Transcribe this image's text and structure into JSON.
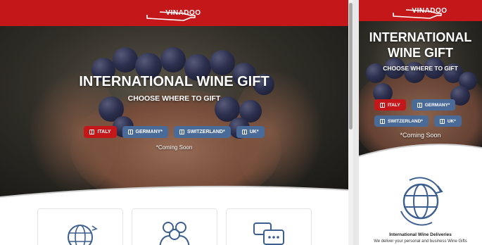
{
  "brand": {
    "name": "VINADOO"
  },
  "hero": {
    "title": "INTERNATIONAL WINE GIFT",
    "mobile_title": "INTERNATIONAL WINE GIFT",
    "subtitle": "CHOOSE WHERE TO GIFT",
    "coming_soon": "*Coming Soon",
    "countries": [
      {
        "label": "ITALY",
        "active": true
      },
      {
        "label": "GERMANY*",
        "active": false
      },
      {
        "label": "SWITZERLAND*",
        "active": false
      },
      {
        "label": "UK*",
        "active": false
      }
    ]
  },
  "features": {
    "icons": [
      "globe-delivery-icon",
      "people-icon",
      "chat-bubbles-icon"
    ]
  },
  "mobile_feature": {
    "title": "International Wine Deliveries",
    "text": "We deliver your personal and business Wine Gifts"
  },
  "colors": {
    "brand_red": "#c4171a",
    "button_blue": "#4a6a97",
    "icon_blue": "#3d5f8f"
  }
}
